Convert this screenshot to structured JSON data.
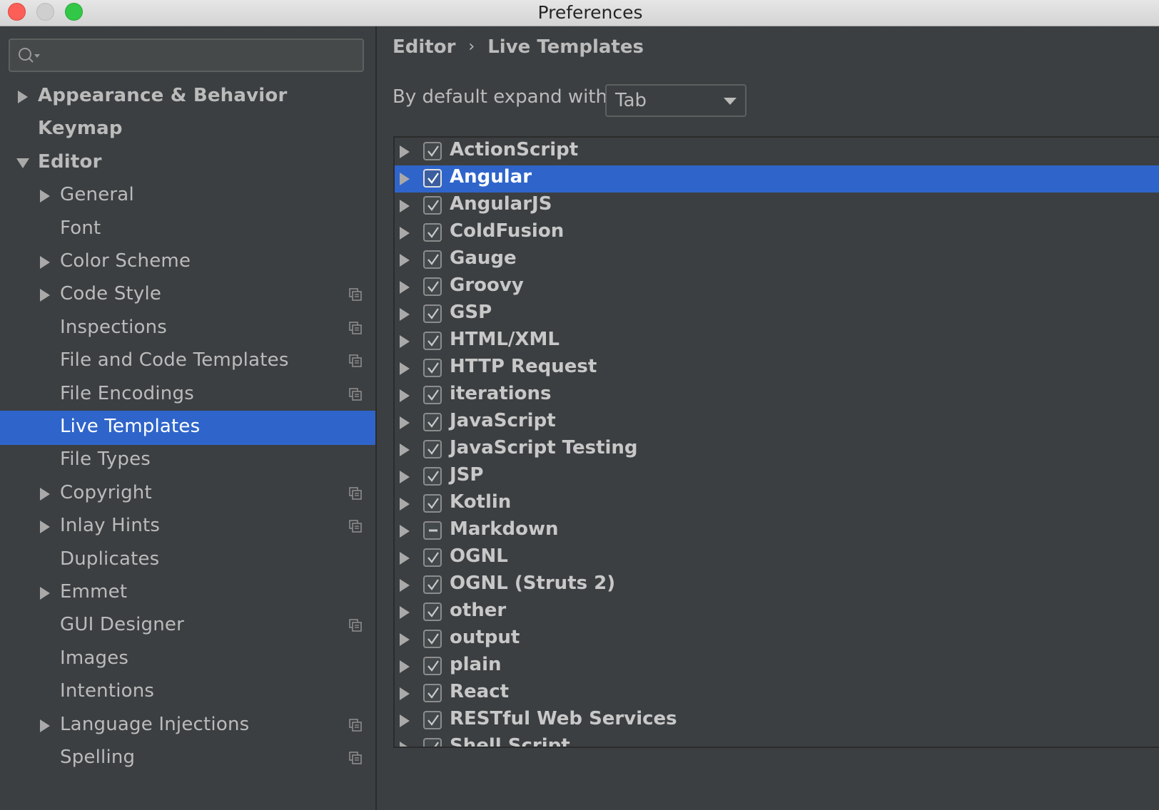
{
  "window": {
    "title": "Preferences"
  },
  "search": {
    "placeholder": ""
  },
  "sidebar": {
    "items": [
      {
        "label": "Appearance & Behavior",
        "level": 0,
        "expand": "collapsed",
        "bold": true,
        "project_icon": false,
        "selected": false
      },
      {
        "label": "Keymap",
        "level": 0,
        "expand": "none",
        "bold": true,
        "project_icon": false,
        "selected": false
      },
      {
        "label": "Editor",
        "level": 0,
        "expand": "expanded",
        "bold": true,
        "project_icon": false,
        "selected": false
      },
      {
        "label": "General",
        "level": 1,
        "expand": "collapsed",
        "bold": false,
        "project_icon": false,
        "selected": false
      },
      {
        "label": "Font",
        "level": 1,
        "expand": "none",
        "bold": false,
        "project_icon": false,
        "selected": false
      },
      {
        "label": "Color Scheme",
        "level": 1,
        "expand": "collapsed",
        "bold": false,
        "project_icon": false,
        "selected": false
      },
      {
        "label": "Code Style",
        "level": 1,
        "expand": "collapsed",
        "bold": false,
        "project_icon": true,
        "selected": false
      },
      {
        "label": "Inspections",
        "level": 1,
        "expand": "none",
        "bold": false,
        "project_icon": true,
        "selected": false
      },
      {
        "label": "File and Code Templates",
        "level": 1,
        "expand": "none",
        "bold": false,
        "project_icon": true,
        "selected": false
      },
      {
        "label": "File Encodings",
        "level": 1,
        "expand": "none",
        "bold": false,
        "project_icon": true,
        "selected": false
      },
      {
        "label": "Live Templates",
        "level": 1,
        "expand": "none",
        "bold": false,
        "project_icon": false,
        "selected": true
      },
      {
        "label": "File Types",
        "level": 1,
        "expand": "none",
        "bold": false,
        "project_icon": false,
        "selected": false
      },
      {
        "label": "Copyright",
        "level": 1,
        "expand": "collapsed",
        "bold": false,
        "project_icon": true,
        "selected": false
      },
      {
        "label": "Inlay Hints",
        "level": 1,
        "expand": "collapsed",
        "bold": false,
        "project_icon": true,
        "selected": false
      },
      {
        "label": "Duplicates",
        "level": 1,
        "expand": "none",
        "bold": false,
        "project_icon": false,
        "selected": false
      },
      {
        "label": "Emmet",
        "level": 1,
        "expand": "collapsed",
        "bold": false,
        "project_icon": false,
        "selected": false
      },
      {
        "label": "GUI Designer",
        "level": 1,
        "expand": "none",
        "bold": false,
        "project_icon": true,
        "selected": false
      },
      {
        "label": "Images",
        "level": 1,
        "expand": "none",
        "bold": false,
        "project_icon": false,
        "selected": false
      },
      {
        "label": "Intentions",
        "level": 1,
        "expand": "none",
        "bold": false,
        "project_icon": false,
        "selected": false
      },
      {
        "label": "Language Injections",
        "level": 1,
        "expand": "collapsed",
        "bold": false,
        "project_icon": true,
        "selected": false
      },
      {
        "label": "Spelling",
        "level": 1,
        "expand": "none",
        "bold": false,
        "project_icon": true,
        "selected": false
      }
    ]
  },
  "main": {
    "breadcrumb": {
      "parent": "Editor",
      "separator": "›",
      "current": "Live Templates"
    },
    "expand_with": {
      "label": "By default expand with",
      "value": "Tab"
    },
    "templates": [
      {
        "label": "ActionScript",
        "state": "checked",
        "selected": false
      },
      {
        "label": "Angular",
        "state": "checked",
        "selected": true
      },
      {
        "label": "AngularJS",
        "state": "checked",
        "selected": false
      },
      {
        "label": "ColdFusion",
        "state": "checked",
        "selected": false
      },
      {
        "label": "Gauge",
        "state": "checked",
        "selected": false
      },
      {
        "label": "Groovy",
        "state": "checked",
        "selected": false
      },
      {
        "label": "GSP",
        "state": "checked",
        "selected": false
      },
      {
        "label": "HTML/XML",
        "state": "checked",
        "selected": false
      },
      {
        "label": "HTTP Request",
        "state": "checked",
        "selected": false
      },
      {
        "label": "iterations",
        "state": "checked",
        "selected": false
      },
      {
        "label": "JavaScript",
        "state": "checked",
        "selected": false
      },
      {
        "label": "JavaScript Testing",
        "state": "checked",
        "selected": false
      },
      {
        "label": "JSP",
        "state": "checked",
        "selected": false
      },
      {
        "label": "Kotlin",
        "state": "checked",
        "selected": false
      },
      {
        "label": "Markdown",
        "state": "indeterminate",
        "selected": false
      },
      {
        "label": "OGNL",
        "state": "checked",
        "selected": false
      },
      {
        "label": "OGNL (Struts 2)",
        "state": "checked",
        "selected": false
      },
      {
        "label": "other",
        "state": "checked",
        "selected": false
      },
      {
        "label": "output",
        "state": "checked",
        "selected": false
      },
      {
        "label": "plain",
        "state": "checked",
        "selected": false
      },
      {
        "label": "React",
        "state": "checked",
        "selected": false
      },
      {
        "label": "RESTful Web Services",
        "state": "checked",
        "selected": false
      },
      {
        "label": "Shell Script",
        "state": "checked",
        "selected": false
      }
    ]
  },
  "colors": {
    "selection": "#2f65ca",
    "background": "#3c3f41",
    "text": "#bbbbbb"
  }
}
